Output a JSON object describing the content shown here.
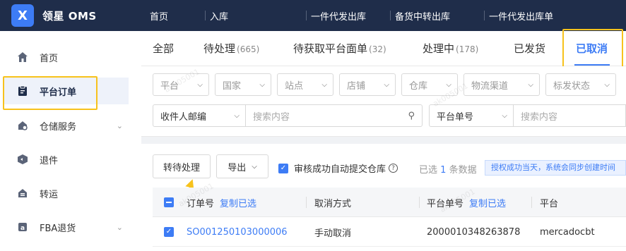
{
  "app": {
    "logo_letter": "X",
    "title": "领星 OMS"
  },
  "topnav": [
    "首页",
    "入库",
    "一件代发出库",
    "备货中转出库",
    "一件代发出库单"
  ],
  "sidebar": {
    "items": [
      {
        "label": "首页",
        "icon": "home-icon"
      },
      {
        "label": "平台订单",
        "icon": "order-icon"
      },
      {
        "label": "仓储服务",
        "icon": "warehouse-icon"
      },
      {
        "label": "退件",
        "icon": "return-icon"
      },
      {
        "label": "转运",
        "icon": "transfer-icon"
      },
      {
        "label": "FBA退货",
        "icon": "fba-icon"
      }
    ]
  },
  "tabs": [
    {
      "label": "全部",
      "count": ""
    },
    {
      "label": "待处理",
      "count": "(665)"
    },
    {
      "label": "待获取平台面单",
      "count": "(32)"
    },
    {
      "label": "处理中",
      "count": "(178)"
    },
    {
      "label": "已发货",
      "count": ""
    },
    {
      "label": "已取消",
      "count": ""
    }
  ],
  "filters": {
    "selects": [
      "平台",
      "国家",
      "站点",
      "店铺",
      "仓库",
      "物流渠道",
      "标发状态"
    ],
    "recipient_zip": "收件人邮编",
    "search_placeholder": "搜索内容",
    "platform_order_no": "平台单号",
    "search_placeholder_2": "搜索内容"
  },
  "toolbar": {
    "to_pending": "转待处理",
    "export": "导出",
    "auto_submit": "审核成功自动提交仓库",
    "selected_prefix": "已选",
    "selected_count": "1",
    "selected_suffix": "条数据",
    "notice": "授权成功当天，系统会同步创建时间"
  },
  "table": {
    "headers": {
      "order_no": "订单号",
      "copy_selected": "复制已选",
      "cancel_method": "取消方式",
      "platform_no": "平台单号",
      "copy_selected_2": "复制已选",
      "platform": "平台"
    },
    "rows": [
      {
        "order_no": "SO001250103000006",
        "cancel_method": "手动取消",
        "platform_no": "2000010348263878",
        "platform": "mercadocbt"
      }
    ]
  },
  "watermark": "ak005001"
}
